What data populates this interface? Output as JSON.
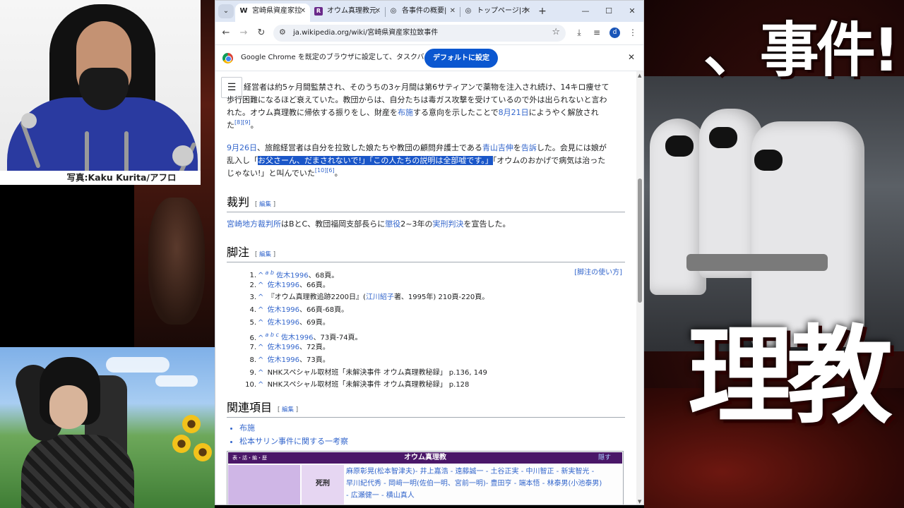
{
  "photo_overlay": {
    "caption": "写真:Kaku Kurita/アフロ"
  },
  "thumbnail": {
    "title_text": "、事件!",
    "kanji_text": "理教"
  },
  "browser": {
    "tabs": [
      {
        "favicon": "W",
        "title": "宮崎県資産家拉",
        "active": true
      },
      {
        "favicon": "R",
        "title": "オウム真理教元…",
        "active": false
      },
      {
        "favicon": "◎",
        "title": "各事件の概要|",
        "active": false
      },
      {
        "favicon": "◎",
        "title": "トップページ|オウ",
        "active": false
      }
    ],
    "new_tab": "+",
    "window_controls": {
      "minimize": "—",
      "maximize": "☐",
      "close": "✕"
    },
    "nav": {
      "back": "←",
      "forward": "→",
      "reload": "↻"
    },
    "url": "ja.wikipedia.org/wiki/宮崎県資産家拉致事件",
    "profile_initial": "d",
    "infobar": {
      "message": "Google Chrome を既定のブラウザに設定して、タスクバーに固定する",
      "button": "デフォルトに設定"
    }
  },
  "article": {
    "toc_icon": "☰",
    "p1": {
      "line1": "経営者は約5ヶ月間監禁され、そのうちの3ヶ月間は第6サティアンで薬物を注入され続け、14キロ痩せて",
      "line2": "歩行困難になるほど衰えていた。教団からは、自分たちは毒ガス攻撃を受けているので外は出られないと言わ",
      "line3a": "れた。オウム真理教に帰依する振りをし、財産を",
      "line3_link1": "布施",
      "line3b": "する意向を示したことで",
      "line3_link2": "8月21日",
      "line3c": "にようやく解放され",
      "line4a": "た",
      "line4_sup": "[8][9]",
      "line4b": "。"
    },
    "p2": {
      "date_link": "9月26日",
      "line1a": "、旅館経営者は自分を拉致した娘たちや教団の顧問弁護士である",
      "lawyer_link": "青山吉伸",
      "line1b": "を",
      "sue_link": "告訴",
      "line1c": "した。会見には娘が",
      "line2a": "乱入し「",
      "highlight": "お父さーん、だまされないで!」「この人たちの説明は全部嘘です。」",
      "line2b": "「オウムのおかげで病気は治った",
      "line3a": "じゃない!」と叫んでいた",
      "line3_sup": "[10][6]",
      "line3b": "。"
    },
    "trial": {
      "heading": "裁判",
      "edit": "編集",
      "court_link": "宮崎地方裁判所",
      "text_a": "はBとC、教団福岡支部長らに",
      "sentence_link": "懲役",
      "text_b": "2~3年の",
      "verdict_link": "実刑判決",
      "text_c": "を宣告した。"
    },
    "notes": {
      "heading": "脚注",
      "edit": "編集",
      "help": "[脚注の使い方]",
      "items": [
        {
          "num": "1.",
          "letters": "a b",
          "link": "佐木1996",
          "rest": "、68頁。"
        },
        {
          "num": "2.",
          "letters": "",
          "link": "佐木1996",
          "rest": "、66頁。"
        },
        {
          "num": "3.",
          "letters": "",
          "link": "",
          "rest_pre": "『オウム真理教追跡2200日』(",
          "mid_link": "江川紹子",
          "rest": "著、1995年) 210頁-220頁。"
        },
        {
          "num": "4.",
          "letters": "",
          "link": "佐木1996",
          "rest": "、66頁-68頁。"
        },
        {
          "num": "5.",
          "letters": "",
          "link": "佐木1996",
          "rest": "、69頁。"
        },
        {
          "num": "6.",
          "letters": "a b c",
          "link": "佐木1996",
          "rest": "、73頁-74頁。"
        },
        {
          "num": "7.",
          "letters": "",
          "link": "佐木1996",
          "rest": "、72頁。"
        },
        {
          "num": "8.",
          "letters": "",
          "link": "佐木1996",
          "rest": "、73頁。"
        },
        {
          "num": "9.",
          "letters": "",
          "link": "",
          "rest": "NHKスペシャル取材班「未解決事件 オウム真理教秘録」 p.136, 149"
        },
        {
          "num": "10.",
          "letters": "",
          "link": "",
          "rest": "NHKスペシャル取材班「未解決事件 オウム真理教秘録」 p.128"
        }
      ]
    },
    "related": {
      "heading": "関連項目",
      "edit": "編集",
      "items": [
        "布施",
        "松本サリン事件に関する一考察"
      ]
    },
    "navbox": {
      "vte": "表・話・編・歴",
      "title": "オウム真理教",
      "hide": "隠す",
      "group_label": "死刑",
      "line1": "麻原彰晃(松本智津夫)- 井上嘉浩 - 遠藤誠一 - 土谷正実 - 中川智正 - 新実智光 -",
      "line2": "早川紀代秀 - 岡﨑一明(佐伯一明、宮前一明)- 豊田亨 - 端本悟 - 林泰男(小池泰男)",
      "line3": "- 広瀬健一 - 横山真人"
    }
  }
}
